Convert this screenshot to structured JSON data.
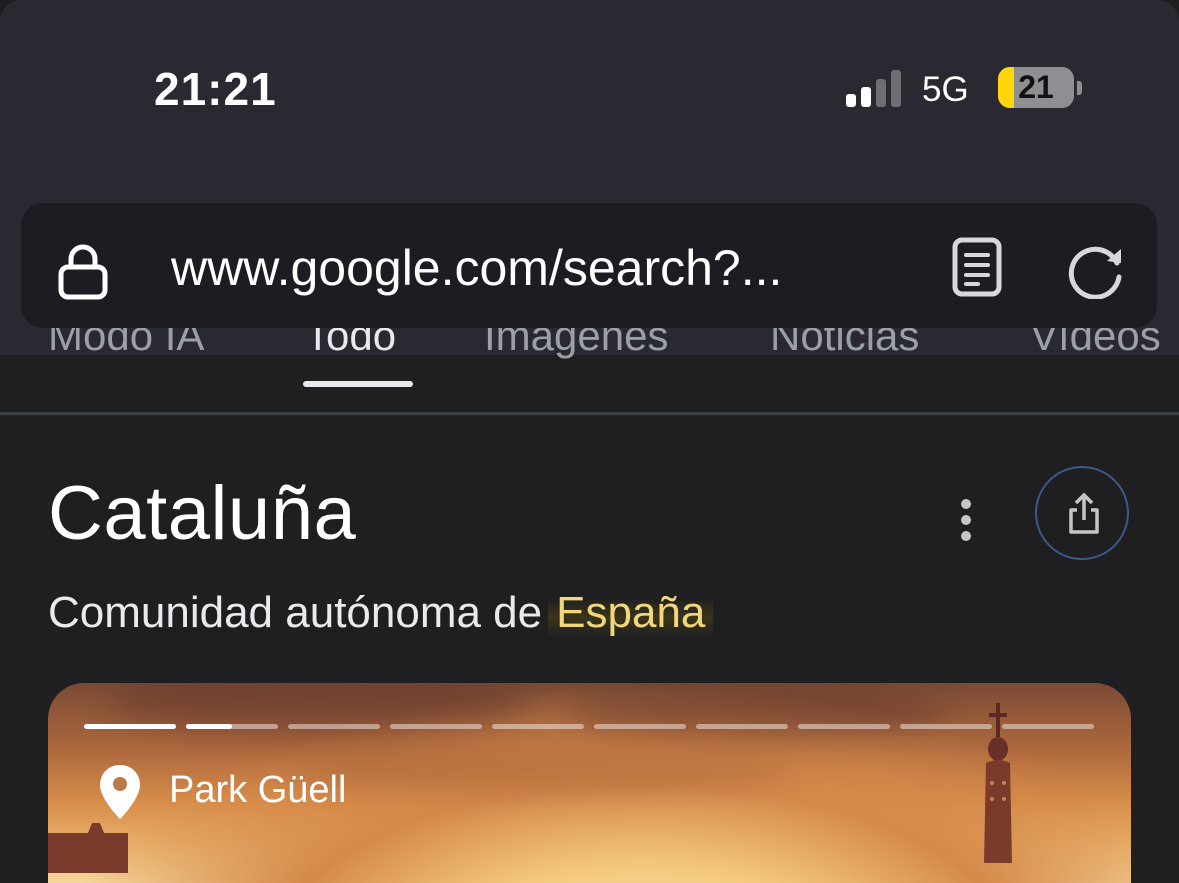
{
  "status_bar": {
    "time": "21:21",
    "network": "5G",
    "battery_percent": "21",
    "signal_bars_active": 2,
    "signal_bars_total": 4
  },
  "browser": {
    "url": "www.google.com/search?...",
    "lock_icon": "lock-icon",
    "reader_icon": "reader-mode-icon",
    "reload_icon": "reload-icon"
  },
  "tabs": [
    {
      "label": "Modo IA",
      "active": false
    },
    {
      "label": "Todo",
      "active": true
    },
    {
      "label": "Imágenes",
      "active": false
    },
    {
      "label": "Noticias",
      "active": false
    },
    {
      "label": "Vídeos",
      "active": false
    }
  ],
  "knowledge_panel": {
    "title": "Cataluña",
    "subtitle_prefix": "Comunidad autónoma de",
    "subtitle_link": "España",
    "image": {
      "place_label": "Park Güell",
      "slides_total": 10,
      "current_slide": 2,
      "current_slide_progress": 0.5
    }
  },
  "colors": {
    "background": "#1f1f22",
    "top_bar": "#2a2931",
    "link_highlight": "#f1d67a",
    "battery_fill": "#ffd60a"
  }
}
